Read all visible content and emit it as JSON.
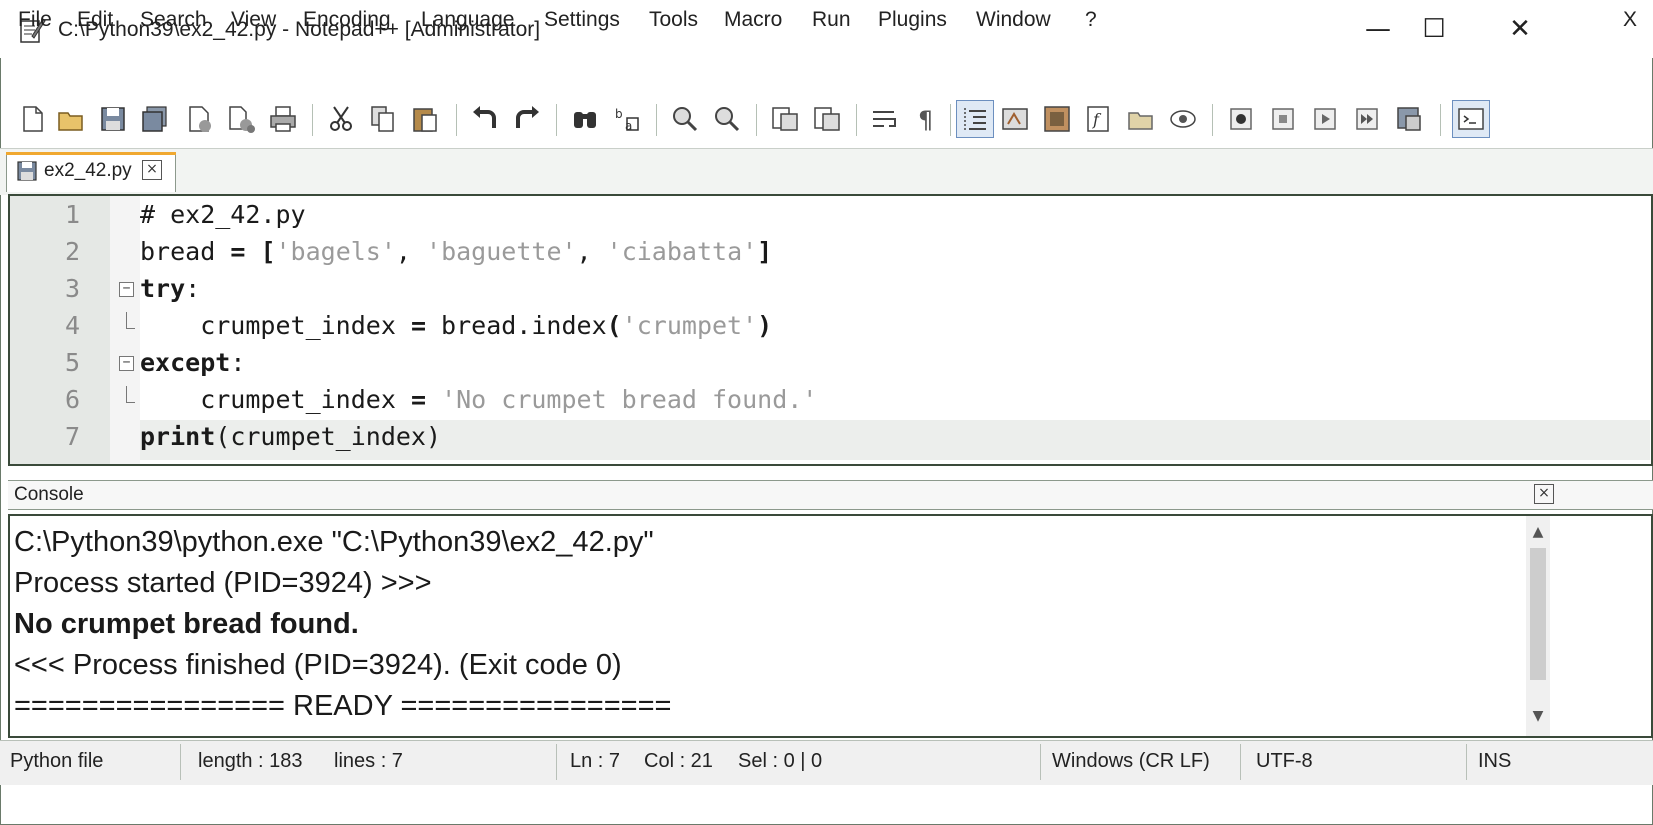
{
  "window": {
    "title": "C:\\Python39\\ex2_42.py - Notepad++ [Administrator]",
    "minimize_glyph": "—",
    "maximize_glyph": "☐",
    "close_glyph": "✕"
  },
  "menu": {
    "items": [
      "File",
      "Edit",
      "Search",
      "View",
      "Encoding",
      "Language",
      "Settings",
      "Tools",
      "Macro",
      "Run",
      "Plugins",
      "Window",
      "?"
    ],
    "close_label": "X"
  },
  "toolbar": {
    "icons": [
      "new-file-icon",
      "open-file-icon",
      "save-icon",
      "save-all-icon",
      "close-icon",
      "close-all-icon",
      "print-icon",
      "cut-icon",
      "copy-icon",
      "paste-icon",
      "undo-icon",
      "redo-icon",
      "find-icon",
      "replace-icon",
      "zoom-in-icon",
      "zoom-out-icon",
      "sync-vertical-icon",
      "sync-horizontal-icon",
      "word-wrap-icon",
      "show-all-chars-icon",
      "indent-guide-icon",
      "user-defined-language-icon",
      "document-map-icon",
      "function-list-icon",
      "folder-as-workspace-icon",
      "monitoring-icon",
      "record-macro-icon",
      "stop-record-icon",
      "play-macro-icon",
      "run-macro-multiple-icon",
      "save-macro-icon",
      "console-icon"
    ]
  },
  "tab": {
    "label": "ex2_42.py",
    "close_glyph": "×"
  },
  "editor": {
    "line_numbers": [
      "1",
      "2",
      "3",
      "4",
      "5",
      "6",
      "7"
    ],
    "fold_open": "−"
  },
  "console": {
    "title": "Console",
    "close_glyph": "×",
    "lines": [
      "C:\\Python39\\python.exe \"C:\\Python39\\ex2_42.py\"",
      "Process started (PID=3924) >>>",
      "No crumpet bread found.",
      "<<< Process finished (PID=3924). (Exit code 0)",
      "================ READY ================"
    ]
  },
  "status": {
    "file_type": "Python file",
    "length": "length : 183",
    "lines": "lines : 7",
    "ln": "Ln : 7",
    "col": "Col : 21",
    "sel": "Sel : 0 | 0",
    "eol": "Windows (CR LF)",
    "encoding": "UTF-8",
    "mode": "INS"
  },
  "colors": {
    "current_line": "#eceeec",
    "gutter": "#e5e8e5",
    "string": "#9a9a9a",
    "tab_accent": "#f0a830"
  }
}
